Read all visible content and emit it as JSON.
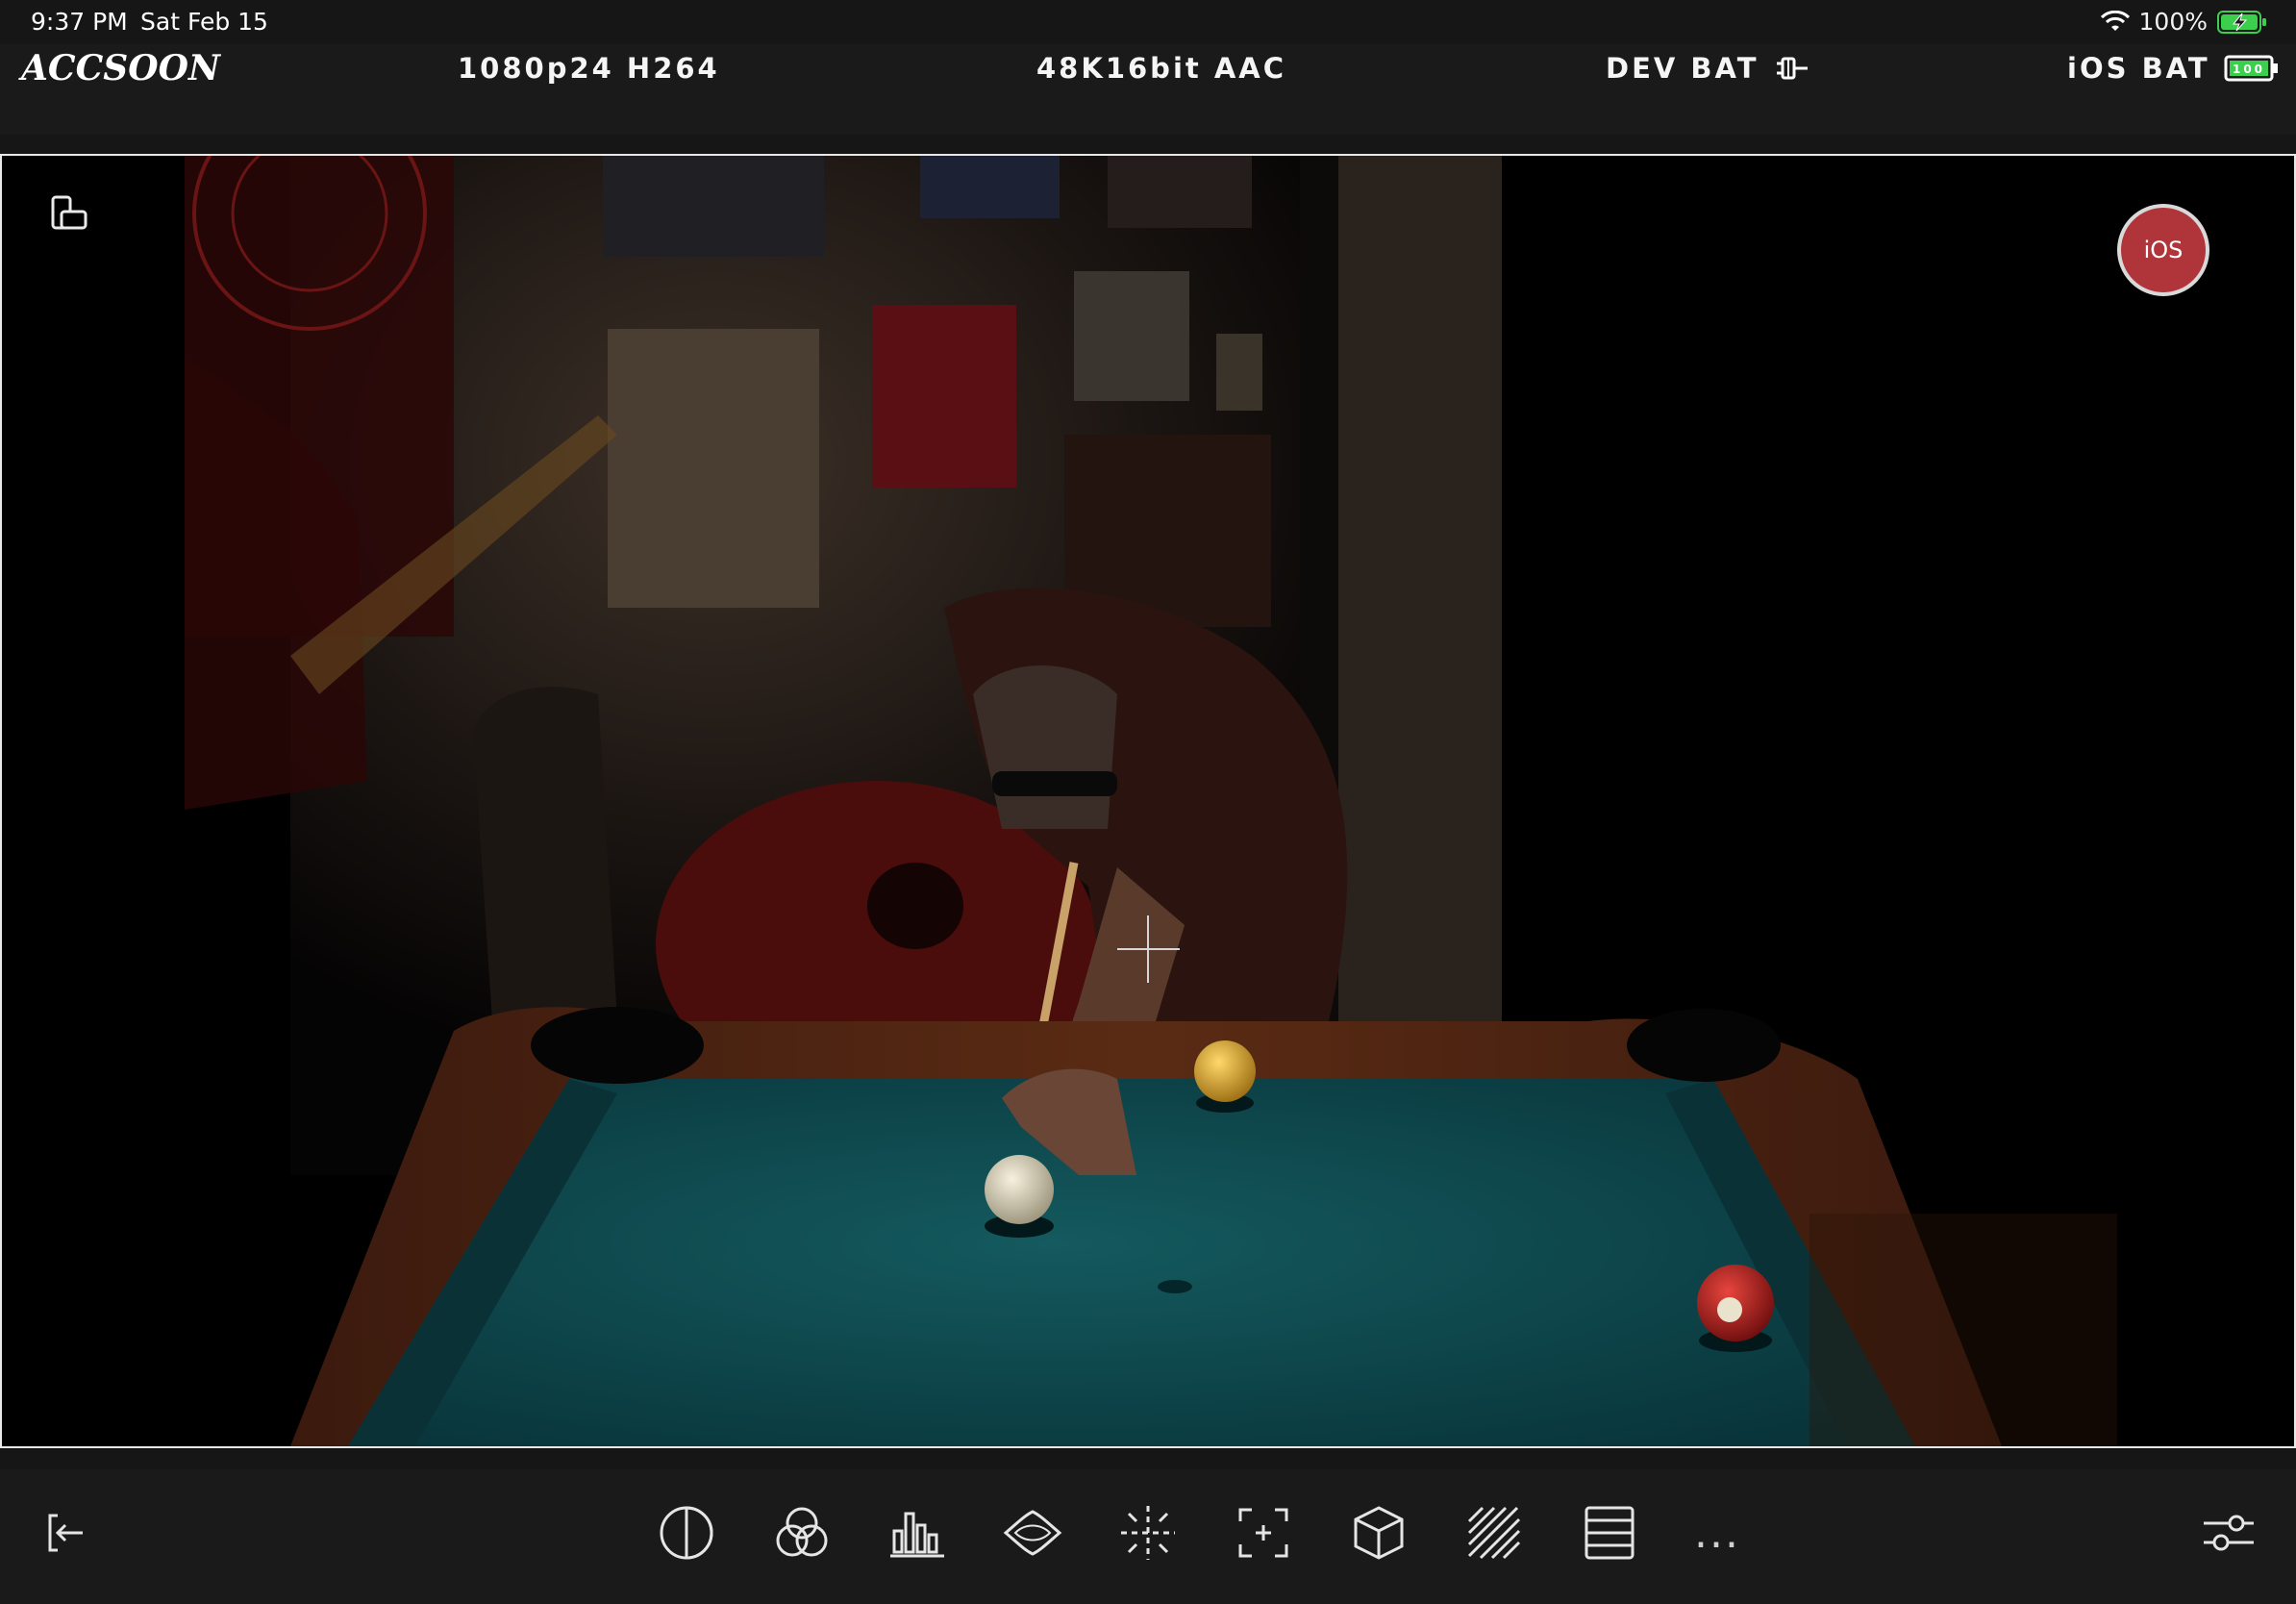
{
  "status_bar": {
    "time": "9:37 PM",
    "date": "Sat Feb 15",
    "battery_percent": "100%",
    "battery_level": 100
  },
  "info_bar": {
    "logo": "ACCSOON",
    "video_format": "1080p24 H264",
    "audio_format": "48K16bit AAC",
    "device_battery_label": "DEV BAT",
    "ios_battery_label": "iOS BAT",
    "ios_battery_value": "100"
  },
  "preview": {
    "record_button_label": "iOS",
    "icons": [
      "rotate-phone-icon",
      "crosshair-icon"
    ]
  },
  "toolbar": {
    "left": "exit-icon",
    "tools": [
      "false-color-icon",
      "rgb-channels-icon",
      "histogram-icon",
      "waveform-icon",
      "center-marker-icon",
      "frame-guide-icon",
      "lut-cube-icon",
      "zebra-icon",
      "grid-lines-icon",
      "more-icon"
    ],
    "more_label": "...",
    "right": "settings-sliders-icon"
  },
  "colors": {
    "background": "#161616",
    "record": "#b0353a",
    "battery_green": "#3ccf4e",
    "felt": "#0e4a4e"
  }
}
